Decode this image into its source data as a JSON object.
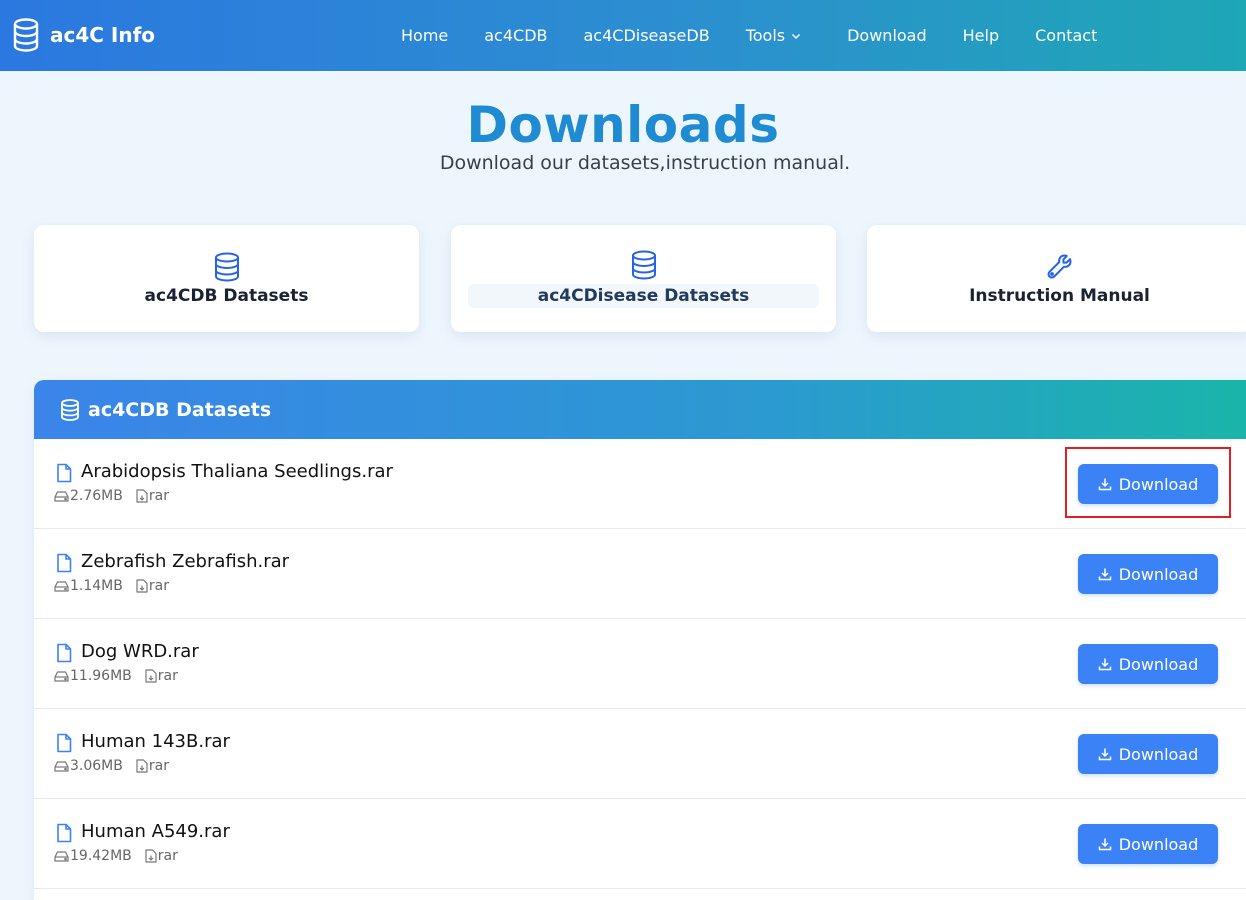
{
  "brand": {
    "name": "ac4C Info",
    "icon": "database-icon"
  },
  "nav": {
    "items": [
      {
        "label": "Home"
      },
      {
        "label": "ac4CDB"
      },
      {
        "label": "ac4CDiseaseDB"
      },
      {
        "label": "Tools",
        "dropdown": true
      },
      {
        "label": "Download"
      },
      {
        "label": "Help"
      },
      {
        "label": "Contact"
      }
    ]
  },
  "hero": {
    "title": "Downloads",
    "subtitle": "Download our datasets,instruction manual."
  },
  "cards": [
    {
      "label": "ac4CDB Datasets",
      "icon": "database-icon"
    },
    {
      "label": "ac4CDisease Datasets",
      "icon": "database-icon"
    },
    {
      "label": "Instruction Manual",
      "icon": "wrench-icon"
    }
  ],
  "panel": {
    "title": "ac4CDB Datasets",
    "download_label": "Download",
    "files": [
      {
        "name": "Arabidopsis Thaliana Seedlings.rar",
        "size": "2.76MB",
        "type": "rar"
      },
      {
        "name": "Zebrafish Zebrafish.rar",
        "size": "1.14MB",
        "type": "rar"
      },
      {
        "name": "Dog WRD.rar",
        "size": "11.96MB",
        "type": "rar"
      },
      {
        "name": "Human 143B.rar",
        "size": "3.06MB",
        "type": "rar"
      },
      {
        "name": "Human A549.rar",
        "size": "19.42MB",
        "type": "rar"
      }
    ]
  },
  "colors": {
    "accent": "#3b82f6",
    "title": "#1f8bd2",
    "highlight": "#e02020"
  }
}
